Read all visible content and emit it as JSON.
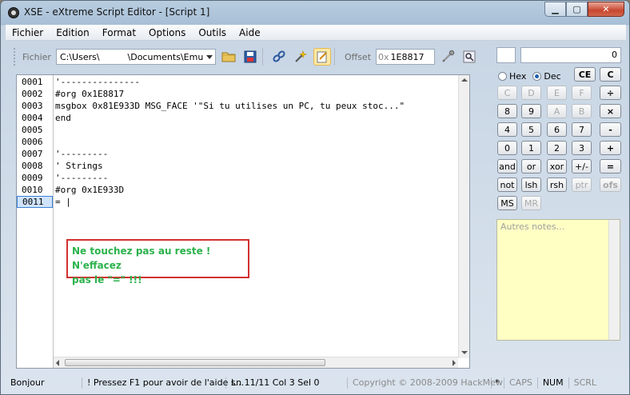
{
  "window": {
    "title": "XSE - eXtreme Script Editor - [Script 1]"
  },
  "menu": [
    "Fichier",
    "Edition",
    "Format",
    "Options",
    "Outils",
    "Aide"
  ],
  "toolbar": {
    "file_label": "Fichier",
    "file_path": "C:\\Users\\          \\Documents\\Emu",
    "offset_label": "Offset",
    "offset_prefix": "0x",
    "offset_value": "1E8817"
  },
  "editor": {
    "line_numbers": [
      "0001",
      "0002",
      "0003",
      "0004",
      "0005",
      "0006",
      "0007",
      "0008",
      "0009",
      "0010",
      "0011"
    ],
    "lines": [
      "'---------------",
      "#org 0x1E8817",
      "msgbox 0x81E933D MSG_FACE '\"Si tu utilises un PC, tu peux stoc...\"",
      "end",
      "",
      "",
      "'---------",
      "' Strings",
      "'---------",
      "#org 0x1E933D",
      "= |"
    ],
    "current_line": 11
  },
  "annotation": {
    "line1": "Ne touchez pas au reste ! N'effacez",
    "line2": "pas le \"=\" !!!",
    "color": "#2bb24c",
    "border_color": "#d23030"
  },
  "calculator": {
    "display": "0",
    "hex_label": "Hex",
    "dec_label": "Dec",
    "mode": "Dec",
    "ce_label": "CE",
    "c_label": "C",
    "buttons": [
      [
        "C",
        "D",
        "E",
        "F",
        "÷"
      ],
      [
        "8",
        "9",
        "A",
        "B",
        "×"
      ],
      [
        "4",
        "5",
        "6",
        "7",
        "-"
      ],
      [
        "0",
        "1",
        "2",
        "3",
        "+"
      ],
      [
        "and",
        "or",
        "xor",
        "+/-",
        "="
      ],
      [
        "not",
        "lsh",
        "rsh",
        "ptr",
        "ofs"
      ],
      [
        "MS",
        "MR"
      ]
    ]
  },
  "notes": {
    "placeholder": "Autres notes..."
  },
  "statusbar": {
    "status": "Bonjour",
    "hint": "! Pressez F1 pour avoir de l'aide s...",
    "position": "Ln 11/11  Col 3  Sel 0",
    "copyright": "Copyright © 2008-2009 HackMew",
    "modified": "*",
    "caps": "CAPS",
    "num": "NUM",
    "scrl": "SCRL"
  }
}
